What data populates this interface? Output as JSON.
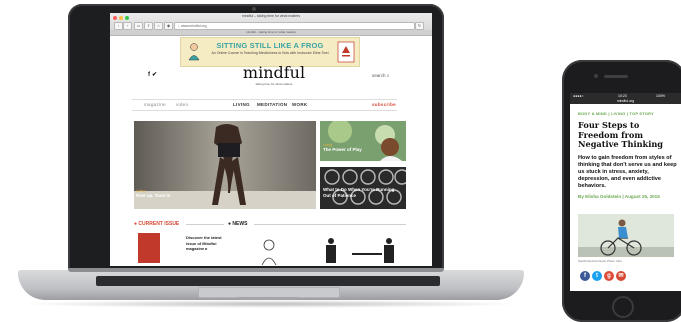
{
  "browser": {
    "window_title": "mindful – taking time for what matters",
    "url": "www.mindful.org",
    "tab_label": "mindful – taking time for what matters"
  },
  "ad": {
    "title": "SITTING STILL LIKE A FROG",
    "subtitle": "An Online Course in Teaching Mindfulness to Kids with Instructor Eline Snel"
  },
  "site": {
    "social_icons": [
      "facebook-icon",
      "twitter-icon"
    ],
    "logo": "mindful",
    "tagline": "taking time for what matters",
    "search_label": "search",
    "nav_left": [
      "magazine",
      "video"
    ],
    "nav_main": [
      "LIVING",
      "MEDITATION",
      "WORK"
    ],
    "subscribe": "subscribe"
  },
  "hero": {
    "tag": "Living",
    "caption": "Rise up. Tune in"
  },
  "cards": [
    {
      "tag": "Living",
      "caption": "The Power of Play"
    },
    {
      "tag": "",
      "caption": "What to Do When You're Running Out of Patience"
    }
  ],
  "sections": {
    "current_issue": "CURRENT ISSUE",
    "news": "NEWS"
  },
  "issue_promo": "Discover the latest issue of Mindful magazine ▸",
  "phone": {
    "status_time": "10:23",
    "status_battery": "100%",
    "status_url": "mindful.org",
    "category": "BODY & MIND | LIVING | TOP STORY",
    "title": "Four Steps to Freedom from Negative Thinking",
    "deck": "How to gain freedom from styles of thinking that don't serve us and keep us stuck in stress, anxiety, depression, and even addictive behaviors.",
    "byline": "By Elisha Goldstein | August 25, 2015",
    "photo_credit": "SplitProduction/Getty Photo Club",
    "share_icons": [
      "facebook-icon",
      "twitter-icon",
      "google-plus-icon",
      "email-icon"
    ],
    "colors": {
      "accent": "#6aa84f"
    }
  },
  "colors": {
    "brand_teal": "#3aa3a3",
    "subscribe_red": "#d64933",
    "highlight_yellow": "#e8b23a"
  }
}
